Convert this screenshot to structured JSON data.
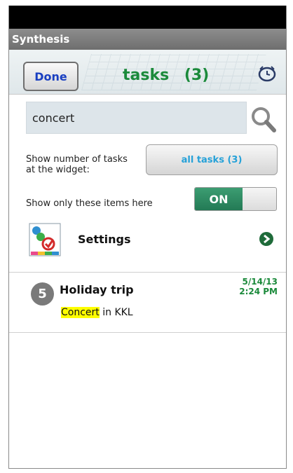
{
  "app": {
    "title": "Synthesis"
  },
  "header": {
    "done_label": "Done",
    "title": "tasks",
    "count": "(3)"
  },
  "search": {
    "value": "concert",
    "icon": "search-icon"
  },
  "widget": {
    "label": "Show number of tasks at the widget:",
    "button_label": "all tasks  (3)"
  },
  "filter": {
    "label": "Show only these items here",
    "toggle_state": "ON"
  },
  "settings": {
    "label": "Settings",
    "icon": "settings-icon",
    "arrow_icon": "chevron-right-circle-icon"
  },
  "tasks": [
    {
      "number": "5",
      "title": "Holiday trip",
      "date": "5/14/13",
      "time": "2:24 PM",
      "note_highlight": "Concert",
      "note_rest": " in KKL"
    }
  ],
  "colors": {
    "accent_green": "#1b8a3b",
    "done_blue": "#1a3fc1",
    "link_blue": "#25a1d8",
    "highlight": "#ffff00"
  }
}
